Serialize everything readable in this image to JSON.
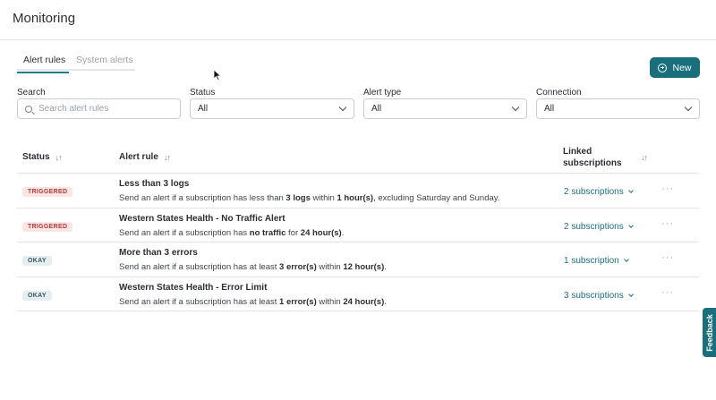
{
  "header": {
    "title": "Monitoring"
  },
  "tabs": [
    {
      "label": "Alert rules",
      "active": true
    },
    {
      "label": "System alerts",
      "active": false
    }
  ],
  "toolbar": {
    "new_label": "New",
    "new_icon": "plus-circle-icon"
  },
  "filters": {
    "search": {
      "label": "Search",
      "placeholder": "Search alert rules",
      "value": ""
    },
    "status": {
      "label": "Status",
      "value": "All"
    },
    "alert_type": {
      "label": "Alert type",
      "value": "All"
    },
    "connection": {
      "label": "Connection",
      "value": "All"
    }
  },
  "table": {
    "columns": {
      "status": "Status",
      "alert_rule": "Alert rule",
      "linked_line1": "Linked",
      "linked_line2": "subscriptions"
    },
    "rows": [
      {
        "status": "TRIGGERED",
        "name": "Less than 3 logs",
        "desc": [
          "Send an alert if a subscription has less than ",
          "3 logs",
          " within ",
          "1 hour(s)",
          ", excluding Saturday and Sunday."
        ],
        "subs": "2 subscriptions"
      },
      {
        "status": "TRIGGERED",
        "name": "Western States Health - No Traffic Alert",
        "desc": [
          "Send an alert if a subscription has ",
          "no traffic",
          " for ",
          "24 hour(s)",
          "."
        ],
        "subs": "2 subscriptions"
      },
      {
        "status": "OKAY",
        "name": "More than 3 errors",
        "desc": [
          "Send an alert if a subscription has at least ",
          "3 error(s)",
          " within ",
          "12 hour(s)",
          "."
        ],
        "subs": "1 subscription"
      },
      {
        "status": "OKAY",
        "name": "Western States Health - Error Limit",
        "desc": [
          "Send an alert if a subscription has at least ",
          "1 error(s)",
          " within ",
          "24 hour(s)",
          "."
        ],
        "subs": "3 subscriptions"
      }
    ],
    "more_icon": "···"
  },
  "feedback": {
    "label": "Feedback"
  },
  "colors": {
    "accent": "#1a6f7c",
    "triggered_bg": "#fbe4e4",
    "triggered_text": "#b83a3a",
    "okay_bg": "#e4edf0",
    "okay_text": "#3b5560"
  }
}
